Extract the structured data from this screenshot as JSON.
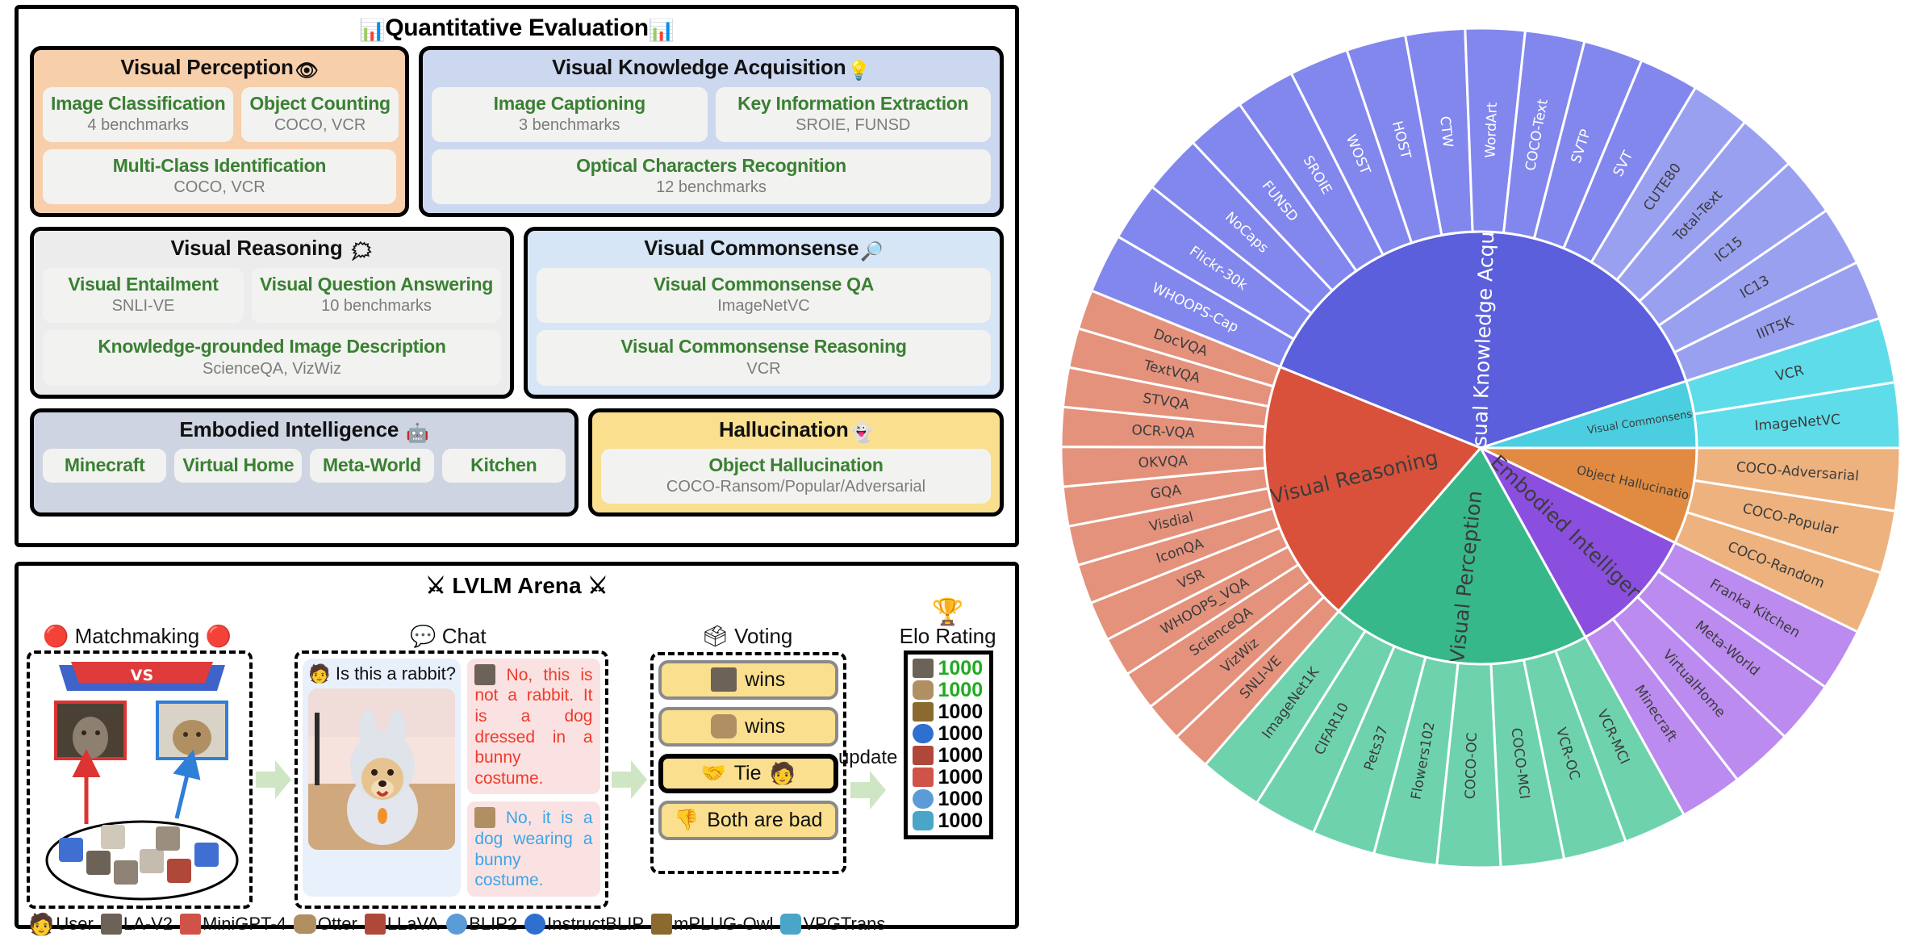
{
  "quant": {
    "title": "Quantitative Evaluation",
    "title_icon": "bar-chart-icon",
    "categories": [
      {
        "name": "Visual Perception",
        "icon": "eye-icon",
        "rows": [
          [
            {
              "name": "Image Classification",
              "sub": "4 benchmarks"
            },
            {
              "name": "Object Counting",
              "sub": "COCO, VCR"
            }
          ],
          [
            {
              "name": "Multi-Class Identification",
              "sub": "COCO, VCR"
            }
          ]
        ]
      },
      {
        "name": "Visual Knowledge Acquisition",
        "icon": "light-bulb-icon",
        "rows": [
          [
            {
              "name": "Image Captioning",
              "sub": "3 benchmarks"
            },
            {
              "name": "Key Information Extraction",
              "sub": "SROIE, FUNSD"
            }
          ],
          [
            {
              "name": "Optical Characters Recognition",
              "sub": "12 benchmarks"
            }
          ]
        ]
      },
      {
        "name": "Visual Reasoning",
        "icon": "thinking-head-icon",
        "rows": [
          [
            {
              "name": "Visual Entailment",
              "sub": "SNLI-VE"
            },
            {
              "name": "Visual Question Answering",
              "sub": "10 benchmarks"
            }
          ],
          [
            {
              "name": "Knowledge-grounded Image Description",
              "sub": "ScienceQA, VizWiz"
            }
          ]
        ]
      },
      {
        "name": "Visual Commonsense",
        "icon": "magnifier-icon",
        "rows": [
          [
            {
              "name": "Visual Commonsense QA",
              "sub": "ImageNetVC"
            }
          ],
          [
            {
              "name": "Visual Commonsense Reasoning",
              "sub": "VCR"
            }
          ]
        ]
      },
      {
        "name": "Embodied Intelligence",
        "icon": "robot-icon",
        "rows": [
          [
            {
              "name": "Minecraft",
              "sub": ""
            },
            {
              "name": "Virtual Home",
              "sub": ""
            },
            {
              "name": "Meta-World",
              "sub": ""
            },
            {
              "name": "Kitchen",
              "sub": ""
            }
          ]
        ]
      },
      {
        "name": "Hallucination",
        "icon": "ghost-icon",
        "rows": [
          [
            {
              "name": "Object Hallucination",
              "sub": "COCO-Ransom/Popular/Adversarial"
            }
          ]
        ]
      }
    ]
  },
  "arena": {
    "title": "LVLM Arena",
    "title_icon": "crossed-swords-icon",
    "stages": [
      {
        "label": "Matchmaking",
        "icon": "pokeball-icon"
      },
      {
        "label": "Chat",
        "icon": "speech-bubble-icon"
      },
      {
        "label": "Voting",
        "icon": "ballot-box-icon"
      },
      {
        "label": "Elo Rating",
        "icon": "trophy-icon"
      }
    ],
    "chat": {
      "question": "Is this a rabbit?",
      "question_icon": "user-avatar-icon",
      "image_alt": "dog-in-bunny-costume-photo",
      "answers": [
        {
          "model_icon": "la-v2-icon",
          "text": "No, this is not a rabbit. It is a dog dressed in a bunny costume.",
          "color": "red"
        },
        {
          "model_icon": "otter-icon",
          "text": "No, it is a dog wearing a bunny costume.",
          "color": "blue"
        }
      ]
    },
    "voting": {
      "options": [
        {
          "label": "wins",
          "icon": "la-v2-icon",
          "selected": false
        },
        {
          "label": "wins",
          "icon": "otter-icon",
          "selected": false
        },
        {
          "label": "Tie",
          "icon": "handshake-icon",
          "selected": true,
          "trailing_icon": "user-avatar-icon"
        },
        {
          "label": "Both are bad",
          "icon": "thumbs-down-icon",
          "selected": false
        }
      ]
    },
    "update_label": "update",
    "elo": {
      "label": "Elo Rating",
      "rows": [
        {
          "icon": "la-v2-icon",
          "value": "1000",
          "color": "#22aa22"
        },
        {
          "icon": "otter-icon",
          "value": "1000",
          "color": "#22aa22"
        },
        {
          "icon": "mplug-owl-icon",
          "value": "1000",
          "color": "#000000"
        },
        {
          "icon": "instructblip-icon",
          "value": "1000",
          "color": "#000000"
        },
        {
          "icon": "llava-icon",
          "value": "1000",
          "color": "#000000"
        },
        {
          "icon": "minigpt4-icon",
          "value": "1000",
          "color": "#000000"
        },
        {
          "icon": "blip2-icon",
          "value": "1000",
          "color": "#000000"
        },
        {
          "icon": "vpgtrans-icon",
          "value": "1000",
          "color": "#000000"
        }
      ]
    },
    "legend": [
      {
        "label": "User",
        "icon": "user-avatar-icon"
      },
      {
        "label": "LA-V2",
        "icon": "la-v2-icon"
      },
      {
        "label": "MiniGPT-4",
        "icon": "minigpt4-icon"
      },
      {
        "label": "Otter",
        "icon": "otter-icon"
      },
      {
        "label": "LLaVA",
        "icon": "llava-icon"
      },
      {
        "label": "BLIP2",
        "icon": "blip2-icon"
      },
      {
        "label": "InstructBLIP",
        "icon": "instructblip-icon"
      },
      {
        "label": "mPLUG-Owl",
        "icon": "mplug-owl-icon"
      },
      {
        "label": "VPGTrans",
        "icon": "vpgtrans-icon"
      }
    ]
  },
  "chart_data": {
    "type": "pie",
    "title": "",
    "layout": "sunburst, two rings, inner ring = capability category, outer ring = benchmark dataset",
    "legend_position": "none",
    "inner_ring": [
      {
        "name": "Visual Knowledge Acquisition",
        "color": "#5b5fdb",
        "value": 16,
        "start_deg": -68,
        "end_deg": 72
      },
      {
        "name": "Visual Commonsense",
        "color": "#4bcfe0",
        "value": 2,
        "start_deg": 72,
        "end_deg": 90
      },
      {
        "name": "Object Hallucination",
        "color": "#e08b41",
        "value": 3,
        "start_deg": 90,
        "end_deg": 116
      },
      {
        "name": "Embodied Intelligence",
        "color": "#8b4fe0",
        "value": 4,
        "start_deg": 116,
        "end_deg": 151
      },
      {
        "name": "Visual Perception",
        "color": "#36b88b",
        "value": 8,
        "start_deg": 151,
        "end_deg": 221
      },
      {
        "name": "Visual Reasoning",
        "color": "#d9513a",
        "value": 14,
        "start_deg": 221,
        "end_deg": 292
      }
    ],
    "outer_ring": [
      {
        "name": "WHOOPS-Cap",
        "parent": "Visual Knowledge Acquisition",
        "color": "#8287ee"
      },
      {
        "name": "Flickr-30k",
        "parent": "Visual Knowledge Acquisition",
        "color": "#8287ee"
      },
      {
        "name": "NoCaps",
        "parent": "Visual Knowledge Acquisition",
        "color": "#8287ee"
      },
      {
        "name": "FUNSD",
        "parent": "Visual Knowledge Acquisition",
        "color": "#8287ee"
      },
      {
        "name": "SROIE",
        "parent": "Visual Knowledge Acquisition",
        "color": "#8287ee"
      },
      {
        "name": "WOST",
        "parent": "Visual Knowledge Acquisition",
        "color": "#8287ee"
      },
      {
        "name": "HOST",
        "parent": "Visual Knowledge Acquisition",
        "color": "#8287ee"
      },
      {
        "name": "CTW",
        "parent": "Visual Knowledge Acquisition",
        "color": "#8287ee"
      },
      {
        "name": "WordArt",
        "parent": "Visual Knowledge Acquisition",
        "color": "#8287ee"
      },
      {
        "name": "COCO-Text",
        "parent": "Visual Knowledge Acquisition",
        "color": "#8287ee"
      },
      {
        "name": "SVTP",
        "parent": "Visual Knowledge Acquisition",
        "color": "#8287ee"
      },
      {
        "name": "SVT",
        "parent": "Visual Knowledge Acquisition",
        "color": "#8287ee"
      },
      {
        "name": "CUTE80",
        "parent": "Visual Knowledge Acquisition",
        "color": "#9aa0f0"
      },
      {
        "name": "Total-Text",
        "parent": "Visual Knowledge Acquisition",
        "color": "#9aa0f0"
      },
      {
        "name": "IC15",
        "parent": "Visual Knowledge Acquisition",
        "color": "#9aa0f0"
      },
      {
        "name": "IC13",
        "parent": "Visual Knowledge Acquisition",
        "color": "#9aa0f0"
      },
      {
        "name": "IIIT5K",
        "parent": "Visual Knowledge Acquisition",
        "color": "#9aa0f0"
      },
      {
        "name": "VCR",
        "parent": "Visual Commonsense",
        "color": "#5fdcea"
      },
      {
        "name": "ImageNetVC",
        "parent": "Visual Commonsense",
        "color": "#5fdcea"
      },
      {
        "name": "COCO-Adversarial",
        "parent": "Object Hallucination",
        "color": "#edb27e"
      },
      {
        "name": "COCO-Popular",
        "parent": "Object Hallucination",
        "color": "#edb27e"
      },
      {
        "name": "COCO-Random",
        "parent": "Object Hallucination",
        "color": "#edb27e"
      },
      {
        "name": "Franka Kitchen",
        "parent": "Embodied Intelligence",
        "color": "#bb8bf0"
      },
      {
        "name": "Meta-World",
        "parent": "Embodied Intelligence",
        "color": "#bb8bf0"
      },
      {
        "name": "VirtualHome",
        "parent": "Embodied Intelligence",
        "color": "#bb8bf0"
      },
      {
        "name": "Minecraft",
        "parent": "Embodied Intelligence",
        "color": "#bb8bf0"
      },
      {
        "name": "VCR-MCI",
        "parent": "Visual Perception",
        "color": "#6ed3ad"
      },
      {
        "name": "VCR-OC",
        "parent": "Visual Perception",
        "color": "#6ed3ad"
      },
      {
        "name": "COCO-MCI",
        "parent": "Visual Perception",
        "color": "#6ed3ad"
      },
      {
        "name": "COCO-OC",
        "parent": "Visual Perception",
        "color": "#6ed3ad"
      },
      {
        "name": "Flowers102",
        "parent": "Visual Perception",
        "color": "#6ed3ad"
      },
      {
        "name": "Pets37",
        "parent": "Visual Perception",
        "color": "#6ed3ad"
      },
      {
        "name": "CIFAR10",
        "parent": "Visual Perception",
        "color": "#6ed3ad"
      },
      {
        "name": "ImageNet1K",
        "parent": "Visual Perception",
        "color": "#6ed3ad"
      },
      {
        "name": "SNLI-VE",
        "parent": "Visual Reasoning",
        "color": "#e4927c"
      },
      {
        "name": "VizWiz",
        "parent": "Visual Reasoning",
        "color": "#e4927c"
      },
      {
        "name": "ScienceQA",
        "parent": "Visual Reasoning",
        "color": "#e4927c"
      },
      {
        "name": "WHOOPS_VQA",
        "parent": "Visual Reasoning",
        "color": "#e4927c"
      },
      {
        "name": "VSR",
        "parent": "Visual Reasoning",
        "color": "#e4927c"
      },
      {
        "name": "IconQA",
        "parent": "Visual Reasoning",
        "color": "#e4927c"
      },
      {
        "name": "Visdial",
        "parent": "Visual Reasoning",
        "color": "#e4927c"
      },
      {
        "name": "GQA",
        "parent": "Visual Reasoning",
        "color": "#e4927c"
      },
      {
        "name": "OKVQA",
        "parent": "Visual Reasoning",
        "color": "#e4927c"
      },
      {
        "name": "OCR-VQA",
        "parent": "Visual Reasoning",
        "color": "#e4927c"
      },
      {
        "name": "STVQA",
        "parent": "Visual Reasoning",
        "color": "#e4927c"
      },
      {
        "name": "TextVQA",
        "parent": "Visual Reasoning",
        "color": "#e4927c"
      },
      {
        "name": "DocVQA",
        "parent": "Visual Reasoning",
        "color": "#e4927c"
      }
    ]
  }
}
